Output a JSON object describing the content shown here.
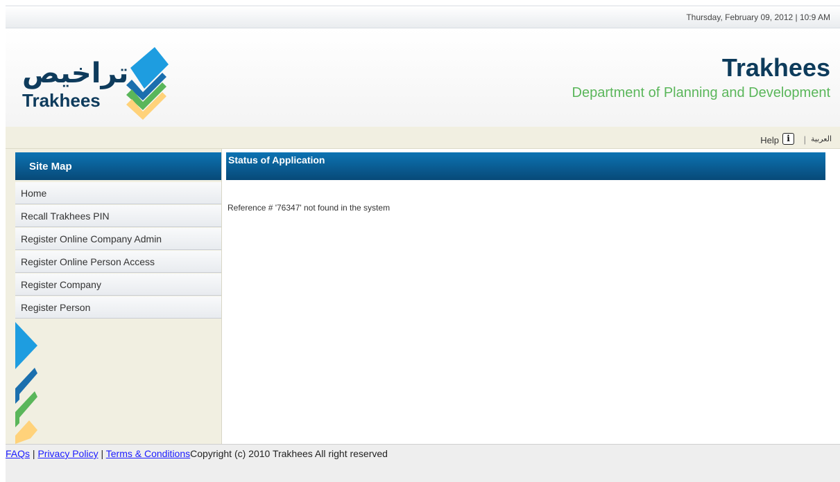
{
  "datetime": "Thursday, February 09, 2012 | 10:9 AM",
  "logo": {
    "arabic": "تراخيص",
    "english": "Trakhees"
  },
  "brand": {
    "title": "Trakhees",
    "subtitle": "Department of Planning and Development"
  },
  "topnav": {
    "help": "Help",
    "info_icon": "info-icon",
    "separator": "|",
    "arabic": "العربية"
  },
  "sidebar": {
    "title": "Site Map",
    "items": [
      {
        "label": "Home"
      },
      {
        "label": "Recall Trakhees PIN"
      },
      {
        "label": "Register Online Company Admin"
      },
      {
        "label": "Register Online Person Access"
      },
      {
        "label": "Register Company"
      },
      {
        "label": "Register Person"
      }
    ]
  },
  "main": {
    "title": "Status of Application",
    "message": "Reference # '76347' not found in the system"
  },
  "footer": {
    "faqs": "FAQs",
    "sep1": " | ",
    "privacy": "Privacy Policy",
    "sep2": " | ",
    "terms": "Terms & Conditions",
    "copyright": "Copyright (c) 2010 Trakhees All right reserved"
  },
  "colors": {
    "accent_blue": "#0a5a8f",
    "brand_green": "#5ab65a",
    "brand_navy": "#0d3b5b",
    "sidebar_bg": "#f1efe1"
  }
}
